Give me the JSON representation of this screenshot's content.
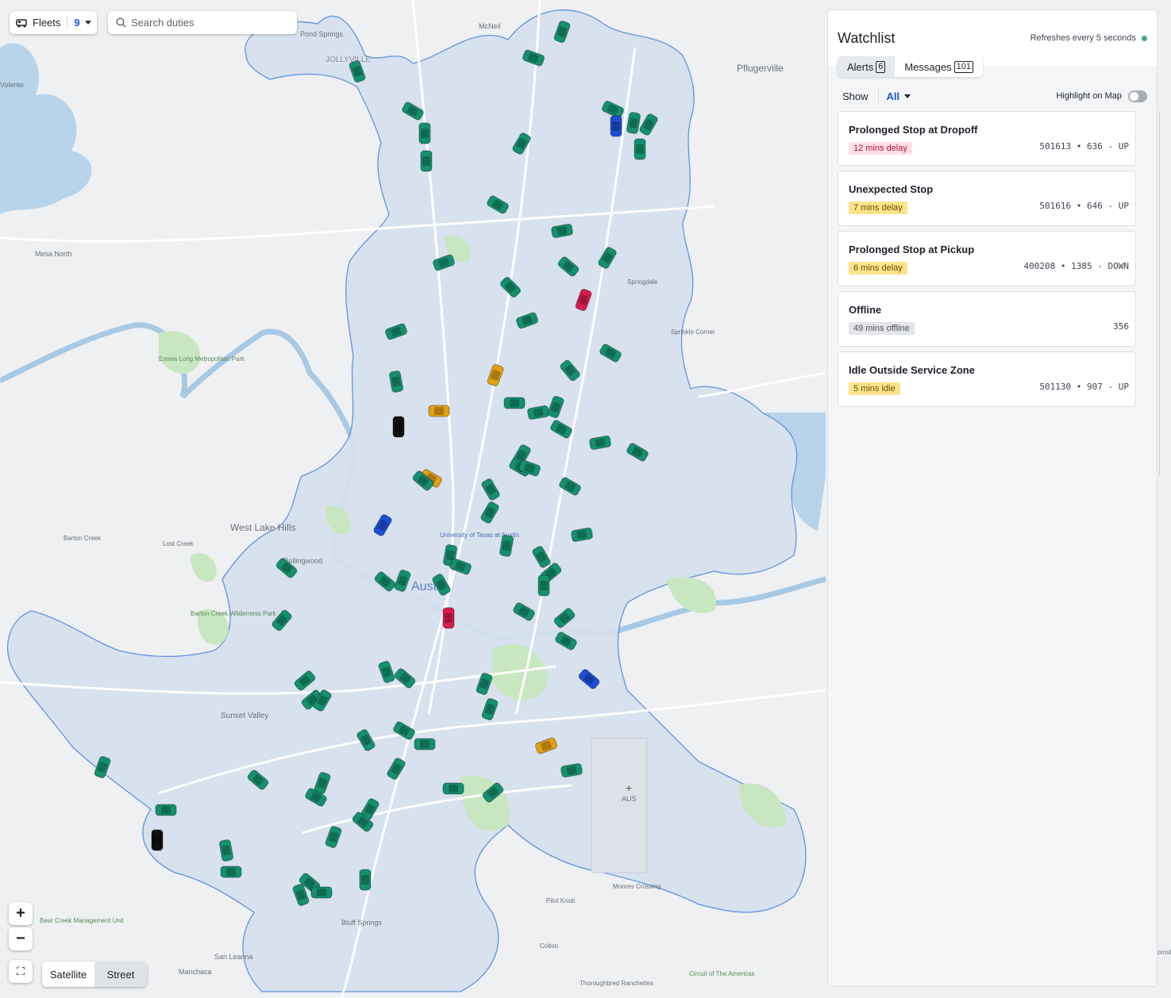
{
  "toolbar": {
    "fleets_label": "Fleets",
    "fleets_count": "9",
    "search_placeholder": "Search duties"
  },
  "map": {
    "labels": [
      {
        "text": "Pond Springs"
      },
      {
        "text": "JOLLYVILLE"
      },
      {
        "text": "McNeil"
      },
      {
        "text": "Pflugerville"
      },
      {
        "text": "Volente"
      },
      {
        "text": "Mesa North"
      },
      {
        "text": "Emma Long Metropolitan Park"
      },
      {
        "text": "Springdale"
      },
      {
        "text": "Sprinkle Corner"
      },
      {
        "text": "West Lake Hills"
      },
      {
        "text": "Barton Creek"
      },
      {
        "text": "Lost Creek"
      },
      {
        "text": "Rollingwood"
      },
      {
        "text": "University of Texas at Austin"
      },
      {
        "text": "Austin"
      },
      {
        "text": "Barton Creek Wilderness Park"
      },
      {
        "text": "Sunset Valley"
      },
      {
        "text": "AUS"
      },
      {
        "text": "Bear Creek Management Unit"
      },
      {
        "text": "Bluff Springs"
      },
      {
        "text": "San Leanna"
      },
      {
        "text": "Manchaca"
      },
      {
        "text": "Moores Crossing"
      },
      {
        "text": "Pilot Knob"
      },
      {
        "text": "Colton"
      },
      {
        "text": "Thoroughbred Ranchettes"
      },
      {
        "text": "Circuit of The Americas"
      },
      {
        "text": "Hornsby Bend"
      }
    ],
    "vehicles": [
      {
        "color": "#15906f"
      },
      {
        "color": "#1d4fd6"
      },
      {
        "color": "#e2a013"
      },
      {
        "color": "#d81b4f"
      },
      {
        "color": "#111111"
      }
    ]
  },
  "controls": {
    "zoom_in": "+",
    "zoom_out": "−",
    "fullscreen": "⛶",
    "satellite": "Satellite",
    "street": "Street"
  },
  "watchlist": {
    "title": "Watchlist",
    "refresh_text": "Refreshes every 5 seconds",
    "tabs": [
      {
        "label": "Alerts",
        "count": "6"
      },
      {
        "label": "Messages",
        "count": "101"
      }
    ],
    "show_label": "Show",
    "show_value": "All",
    "highlight_label": "Highlight on Map",
    "alerts": [
      {
        "title": "Prolonged Stop at Dropoff",
        "badge": "12 mins delay",
        "meta": "501613 • 636 - UP"
      },
      {
        "title": "Unexpected Stop",
        "badge": "7 mins delay",
        "meta": "501616 • 646 - UP"
      },
      {
        "title": "Prolonged Stop at Pickup",
        "badge": "6 mins delay",
        "meta": "400208 • 1385 - DOWN"
      },
      {
        "title": "Offline",
        "badge": "49 mins offline",
        "meta": "356"
      },
      {
        "title": "Idle Outside Service Zone",
        "badge": "5 mins idle",
        "meta": "501130 • 907 - UP"
      }
    ]
  }
}
